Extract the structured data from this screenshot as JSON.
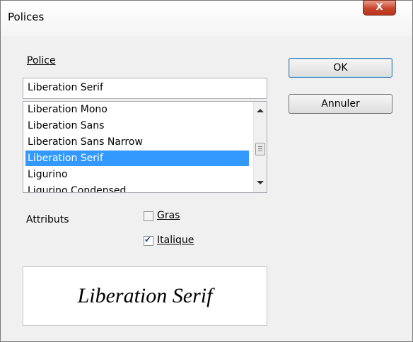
{
  "window": {
    "title": "Polices",
    "close_glyph": "X"
  },
  "font_label": "Police",
  "font_input_value": "Liberation Serif",
  "font_list": [
    {
      "label": "Liberation Mono",
      "selected": false
    },
    {
      "label": "Liberation Sans",
      "selected": false
    },
    {
      "label": "Liberation Sans Narrow",
      "selected": false
    },
    {
      "label": "Liberation Serif",
      "selected": true
    },
    {
      "label": "Ligurino",
      "selected": false
    },
    {
      "label": "Ligurino Condensed",
      "selected": false
    }
  ],
  "buttons": {
    "ok": "OK",
    "cancel": "Annuler"
  },
  "attributes_label": "Attributs",
  "bold": {
    "label": "Gras",
    "checked": false
  },
  "italic": {
    "label": "Italique",
    "checked": true
  },
  "preview_text": "Liberation Serif",
  "colors": {
    "selection": "#3399ff",
    "close_button": "#c7452d"
  }
}
